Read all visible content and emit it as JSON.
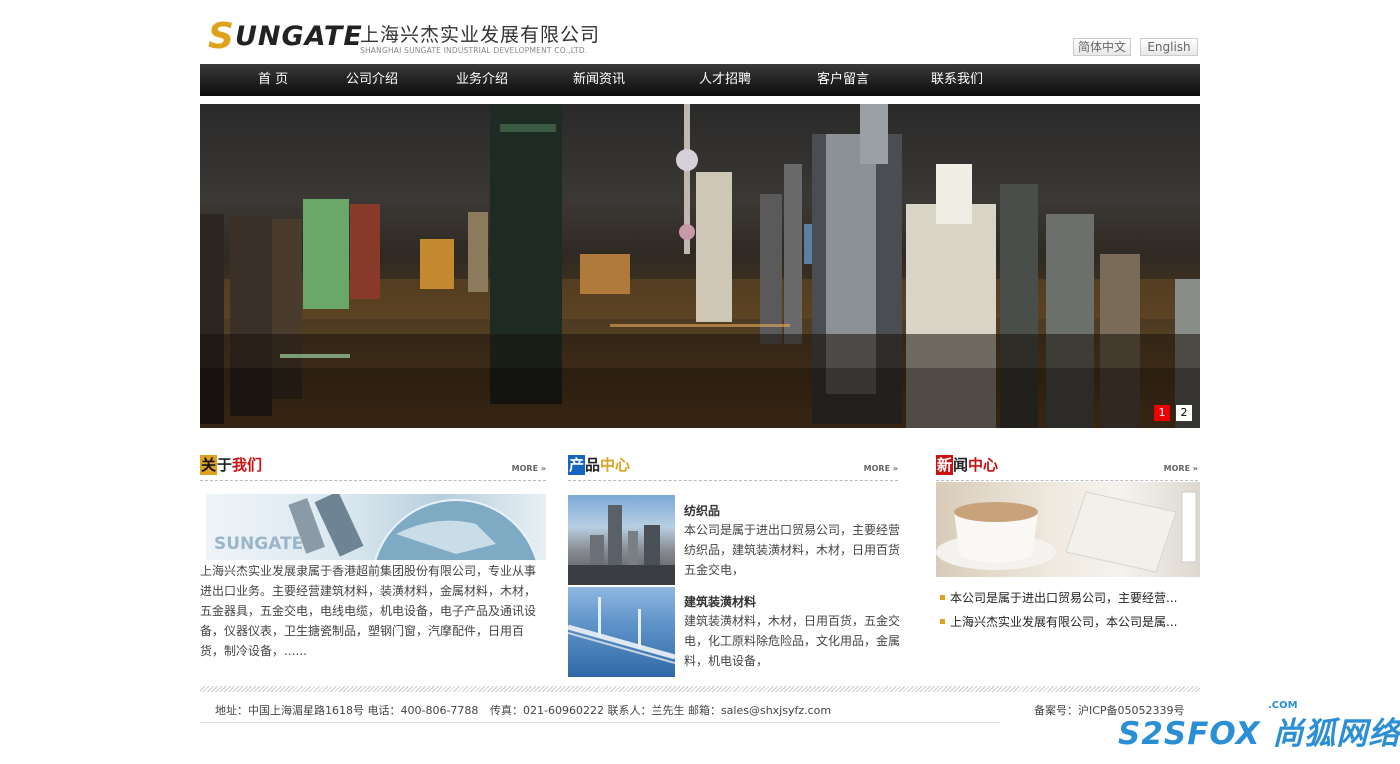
{
  "header": {
    "logo_en_first": "S",
    "logo_en_rest": "UNGATE",
    "logo_cn": "上海兴杰实业发展有限公司",
    "logo_sub": "SHANGHAI SUNGATE INDUSTRIAL DEVELOPMENT CO.,LTD.",
    "lang_cn": "简体中文",
    "lang_en": "English"
  },
  "nav": {
    "items": [
      "首 页",
      "公司介绍",
      "业务介绍",
      "新闻资讯",
      "人才招聘",
      "客户留言",
      "联系我们"
    ]
  },
  "banner": {
    "dots": [
      "1",
      "2"
    ],
    "active_dot": "1",
    "active_color": "#ee0000"
  },
  "about": {
    "title_a": "关",
    "title_b": "于",
    "title_c": "我们",
    "more": "MORE »",
    "image_brand": "SUNGATE",
    "text": "上海兴杰实业发展隶属于香港超前集团股份有限公司，专业从事进出口业务。主要经营建筑材料，装潢材料，金属材料，木材，五金器具，五金交电，电线电缆，机电设备，电子产品及通讯设备，仪器仪表，卫生搪瓷制品，塑钢门窗，汽摩配件，日用百货，制冷设备，......"
  },
  "products": {
    "title_a": "产",
    "title_b": "品",
    "title_c": "中心",
    "more": "MORE »",
    "items": [
      {
        "title": "纺织品",
        "desc": "本公司是属于进出口贸易公司，主要经营纺织品，建筑装潢材料，木材，日用百货五金交电，"
      },
      {
        "title": "建筑装潢材料",
        "desc": "建筑装潢材料，木材，日用百货，五金交电，化工原料除危险品，文化用品，金属料，机电设备，"
      }
    ]
  },
  "news": {
    "title_a": "新",
    "title_b": "闻",
    "title_c": "中心",
    "more": "MORE »",
    "items": [
      "本公司是属于进出口贸易公司，主要经营...",
      "上海兴杰实业发展有限公司，本公司是属..."
    ]
  },
  "footer": {
    "address": "地址：中国上海湄星路1618号 电话：400-806-7788",
    "contact": "传真：021-60960222 联系人：兰先生 邮箱：sales@shxjsyfz.com",
    "icp": "备案号：沪ICP备05052339号"
  },
  "watermark": {
    "com": ".COM",
    "text": "S2SFOX 尚狐网络"
  },
  "colors": {
    "accent_red": "#cc1111",
    "accent_gold": "#e0a21c",
    "accent_blue": "#1565c0"
  }
}
